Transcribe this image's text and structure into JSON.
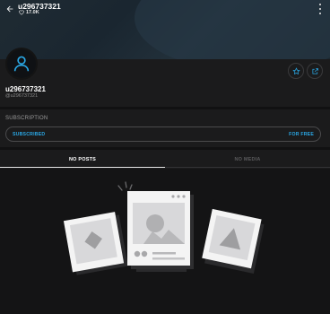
{
  "header": {
    "username": "u296737321",
    "likes_count": "17.0K",
    "back_icon": "arrow-left-icon",
    "more_icon": "more-vertical-icon",
    "heart_icon": "heart-outline-icon"
  },
  "profile": {
    "display_name": "u296737321",
    "handle": "@u296737321",
    "avatar_icon": "user-avatar-icon",
    "star_icon": "star-outline-icon",
    "share_icon": "share-icon"
  },
  "subscription": {
    "section_title": "SUBSCRIPTION",
    "button_left": "SUBSCRIBED",
    "button_right": "FOR FREE"
  },
  "tabs": [
    {
      "label": "NO POSTS",
      "active": true
    },
    {
      "label": "NO MEDIA",
      "active": false
    }
  ],
  "colors": {
    "accent": "#2aa8e6",
    "background": "#1b1b1c",
    "content_background": "#141415"
  },
  "empty_state_icon": "empty-media-illustration"
}
